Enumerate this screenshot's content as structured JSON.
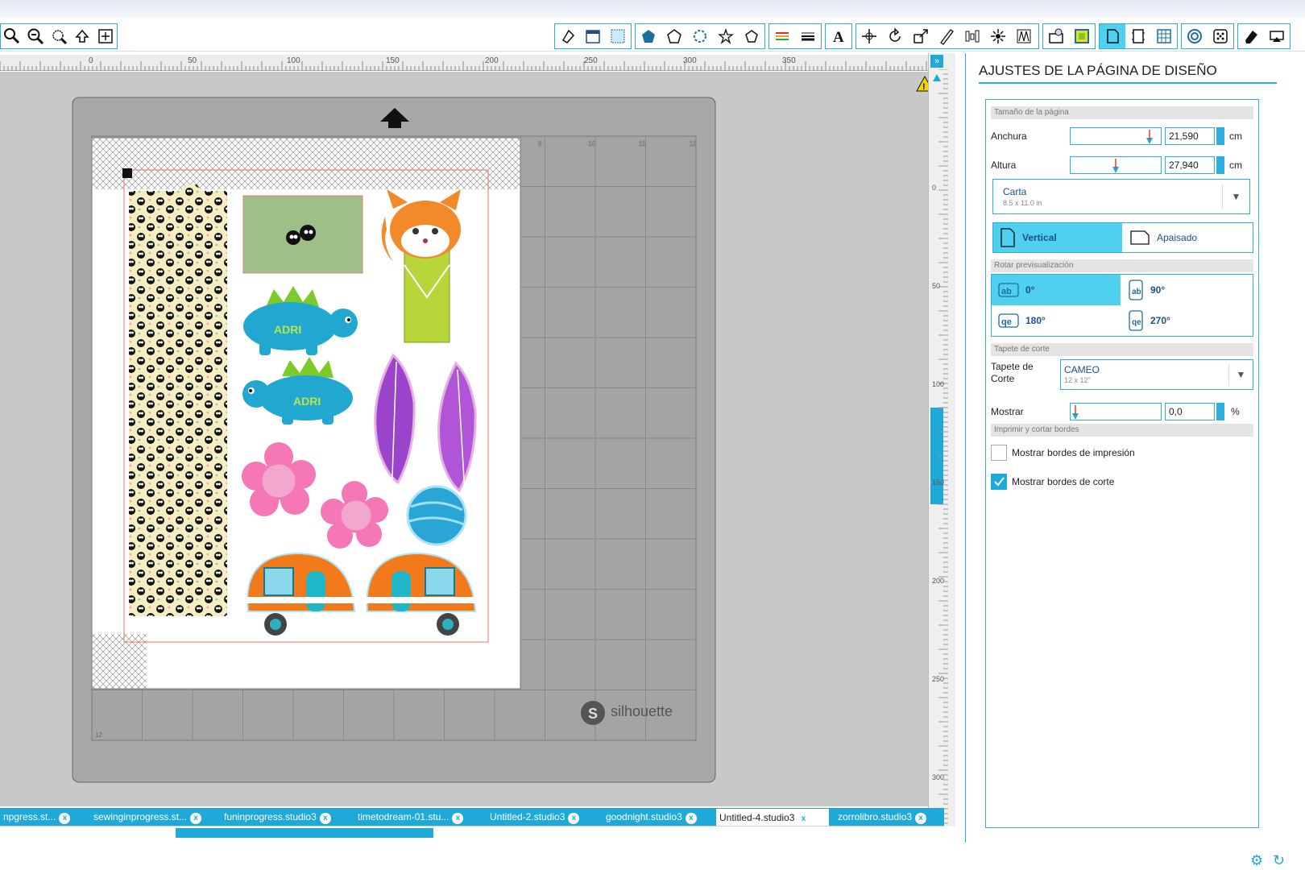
{
  "toolbar": {
    "left_icons": [
      "zoom-out-icon",
      "zoom-in-icon",
      "zoom-select-icon",
      "pan-icon",
      "fit-page-icon"
    ],
    "right_icons": [
      "fill-icon",
      "page-icon",
      "grid-icon",
      "polygon-fill-icon",
      "pentagon-icon",
      "rosette-icon",
      "star-icon",
      "pentagon-outline-icon",
      "line-color-icon",
      "line-style-icon",
      "text-icon",
      "transform-icon",
      "rotate-icon",
      "scale-icon",
      "shear-icon",
      "align-icon",
      "replicate-icon",
      "nest-icon",
      "library-icon",
      "image-icon",
      "page-setup-icon",
      "cut-border-icon",
      "grid-setup-icon",
      "spiral-icon",
      "dots-icon",
      "eraser-icon",
      "send-icon"
    ]
  },
  "ruler": {
    "h_ticks": [
      "0",
      "50",
      "100",
      "150",
      "200",
      "250",
      "300",
      "350"
    ],
    "v_ticks": [
      "0",
      "50",
      "100",
      "150",
      "200",
      "250",
      "300"
    ]
  },
  "mat": {
    "brand": "silhouette",
    "grid_label": "12",
    "col_labels": [
      "9",
      "10",
      "11",
      "12"
    ]
  },
  "stickers": {
    "dino_label_1": "ADRI",
    "dino_label_2": "ADRI"
  },
  "panel": {
    "title": "AJUSTES DE LA PÁGINA DE DISEÑO",
    "page_size_header": "Tamaño de la página",
    "width_label": "Anchura",
    "width_value": "21,590",
    "width_unit": "cm",
    "height_label": "Altura",
    "height_value": "27,940",
    "height_unit": "cm",
    "paper_name": "Carta",
    "paper_size": "8.5 x 11.0 in",
    "orientation_vertical": "Vertical",
    "orientation_landscape": "Apaisado",
    "rotate_header": "Rotar previsualización",
    "rot_0": "0°",
    "rot_90": "90°",
    "rot_180": "180°",
    "rot_270": "270°",
    "mat_header": "Tapete de corte",
    "mat_label": "Tapete de Corte",
    "mat_name": "CAMEO",
    "mat_size": "12 x 12\"",
    "show_label": "Mostrar",
    "show_value": "0,0",
    "show_unit": "%",
    "borders_header": "Imprimir y cortar bordes",
    "print_borders": "Mostrar bordes de impresión",
    "cut_borders": "Mostrar bordes de corte",
    "print_borders_checked": false,
    "cut_borders_checked": true
  },
  "tabs": [
    {
      "label": "npgress.st..."
    },
    {
      "label": "sewinginprogress.st..."
    },
    {
      "label": "funinprogress.studio3"
    },
    {
      "label": "timetodream-01.stu..."
    },
    {
      "label": "Untitled-2.studio3"
    },
    {
      "label": "goodnight.studio3"
    },
    {
      "label": "Untitled-4.studio3"
    },
    {
      "label": "zorrolibro.studio3"
    }
  ],
  "active_tab": 6,
  "colors": {
    "accent": "#2fb0dc",
    "active": "#4fd0ee",
    "mat": "#a8a8a8"
  }
}
